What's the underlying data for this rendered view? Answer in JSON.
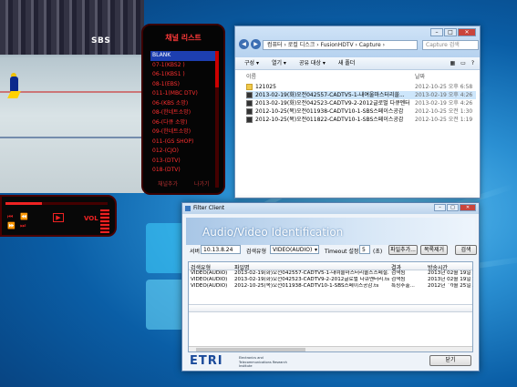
{
  "video_player": {
    "channel_logo": "SBS",
    "channel_list_title": "채널 리스트",
    "channels": [
      "BLANK",
      "07-1(KBS2 )",
      "06-1(KBS1 )",
      "08-1(EBS)",
      "011-1(MBC DTV)",
      "06-(KBS 소망)",
      "08-(한네트소망)",
      "06-(다큐 소망)",
      "09-(한네트소망)",
      "011-(GS SHOP)",
      "012-(CJO)",
      "013-(DTV)",
      "018-(DTV)"
    ],
    "selected_channel_index": 0,
    "channel_buttons": [
      "채널추가",
      "나가기"
    ],
    "volume_label": "VOL",
    "play_icon": "▶",
    "control_icons": [
      "⏮",
      "⏪",
      "⏩",
      "⏭"
    ]
  },
  "explorer": {
    "address": "컴퓨터 › 로컬 디스크 › FusionHDTV › Capture ›",
    "search_placeholder": "Capture 검색",
    "toolbar": [
      "구성 ▾",
      "열기 ▾",
      "공유 대상 ▾",
      "새 폴더"
    ],
    "col_name": "이름",
    "col_date": "날짜",
    "files": [
      {
        "name": "121025",
        "date": "2012-10-25 오후 6:58",
        "folder": true
      },
      {
        "name": "2013-02-19(화)오전042557-CADTV5-1-내여울마스터리쏠...",
        "date": "2013-02-19 오후 4:26",
        "folder": false,
        "selected": true
      },
      {
        "name": "2013-02-19(화)오전042523-CADTV9-2-2012글로벌 다큐멘터리",
        "date": "2013-02-19 오후 4:26",
        "folder": false
      },
      {
        "name": "2012-10-25(목)오전011938-CADTV10-1-SBS스페이스공감",
        "date": "2012-10-25 오전 1:30",
        "folder": false
      },
      {
        "name": "2012-10-25(목)오전011822-CADTV10-1-SBS스페이스공감",
        "date": "2012-10-25 오전 1:19",
        "folder": false
      }
    ]
  },
  "filter_client": {
    "window_title": "Filter Client",
    "header": "Audio/Video Identification",
    "server_label": "서버",
    "server_value": "10.13.8.24",
    "search_type_label": "검색유형",
    "search_type_value": "VIDEO(AUDIO)",
    "timeout_label": "Timeout 설정",
    "timeout_value": "5",
    "timeout_unit": "(초)",
    "buttons": [
      "파일추가...",
      "목록제거",
      "검색"
    ],
    "columns": [
      "검색유형",
      "파일명",
      "결과",
      "방송시간"
    ],
    "rows": [
      {
        "type": "VIDEO(AUDIO)",
        "file": "2013-02-19(화)오전042557-CADTV5-1-내여울마스터리쏠스스페셜...",
        "result": "검색됨",
        "time": "2013년 02월 19일 1"
      },
      {
        "type": "VIDEO(AUDIO)",
        "file": "2013-02-19(화)오전042523-CADTV9-2-2012글로벌 다큐멘터리.ts",
        "result": "검색됨",
        "time": "2013년 02월 19일 1"
      },
      {
        "type": "VIDEO(AUDIO)",
        "file": "2012-10-25(목)오전011938-CADTV10-1-SBS스페이스공감.ts",
        "result": "특징추출...",
        "time": "2012년 10월 25일 ."
      }
    ],
    "logo": "ETRI",
    "logo_sub": "Electronics and Telecommunications Research Institute",
    "close_label": "닫기"
  }
}
